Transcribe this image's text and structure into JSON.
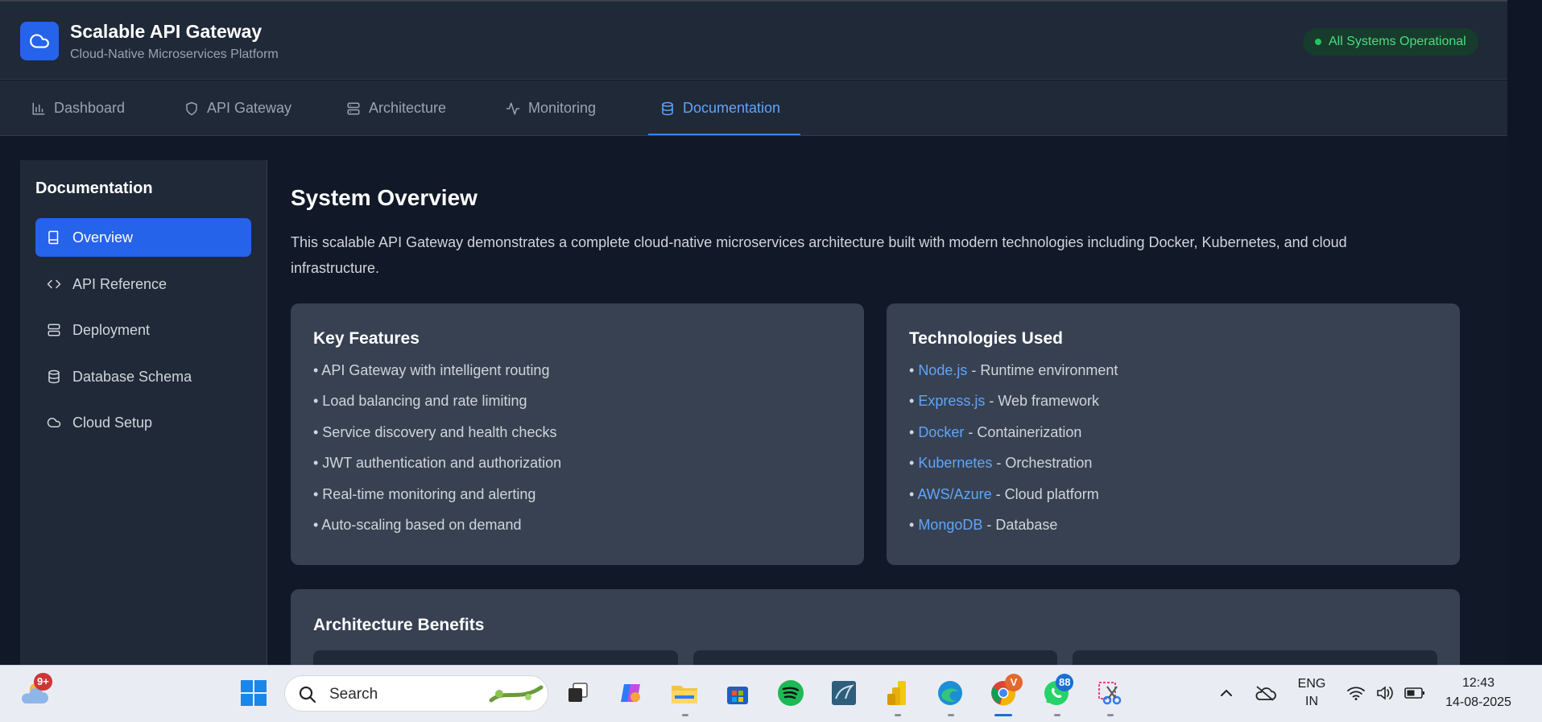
{
  "app": {
    "title": "Scalable API Gateway",
    "subtitle": "Cloud-Native Microservices Platform",
    "status": "All Systems Operational"
  },
  "nav": {
    "tabs": [
      {
        "label": "Dashboard",
        "icon": "bar-chart-icon"
      },
      {
        "label": "API Gateway",
        "icon": "shield-icon"
      },
      {
        "label": "Architecture",
        "icon": "server-icon"
      },
      {
        "label": "Monitoring",
        "icon": "activity-icon"
      },
      {
        "label": "Documentation",
        "icon": "database-icon",
        "active": true
      }
    ]
  },
  "sidebar": {
    "heading": "Documentation",
    "items": [
      {
        "label": "Overview",
        "icon": "book-icon",
        "active": true
      },
      {
        "label": "API Reference",
        "icon": "code-icon"
      },
      {
        "label": "Deployment",
        "icon": "server-icon"
      },
      {
        "label": "Database Schema",
        "icon": "database-icon"
      },
      {
        "label": "Cloud Setup",
        "icon": "cloud-icon"
      }
    ]
  },
  "content": {
    "title": "System Overview",
    "description": "This scalable API Gateway demonstrates a complete cloud-native microservices architecture built with modern technologies including Docker, Kubernetes, and cloud infrastructure.",
    "key_features": {
      "title": "Key Features",
      "items": [
        "• API Gateway with intelligent routing",
        "• Load balancing and rate limiting",
        "• Service discovery and health checks",
        "• JWT authentication and authorization",
        "• Real-time monitoring and alerting",
        "• Auto-scaling based on demand"
      ]
    },
    "technologies": {
      "title": "Technologies Used",
      "items": [
        {
          "name": "Node.js",
          "desc": " - Runtime environment"
        },
        {
          "name": "Express.js",
          "desc": " - Web framework"
        },
        {
          "name": "Docker",
          "desc": " - Containerization"
        },
        {
          "name": "Kubernetes",
          "desc": " - Orchestration"
        },
        {
          "name": "AWS/Azure",
          "desc": " - Cloud platform"
        },
        {
          "name": "MongoDB",
          "desc": " - Database"
        }
      ]
    },
    "benefits": {
      "title": "Architecture Benefits"
    }
  },
  "taskbar": {
    "weather_badge": "9+",
    "search_placeholder": "Search",
    "chrome_badge": "V",
    "whatsapp_badge": "88",
    "language": "ENG",
    "region": "IN",
    "time": "12:43",
    "date": "14-08-2025"
  },
  "colors": {
    "accent": "#2563eb",
    "link": "#60a5fa",
    "status_green": "#4ade80",
    "background": "#111827",
    "panel": "#1f2937",
    "card": "#374151"
  }
}
